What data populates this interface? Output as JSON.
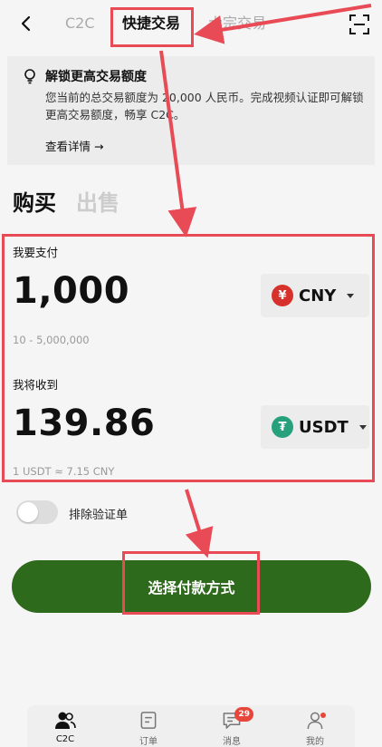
{
  "header": {
    "tabs": [
      "C2C",
      "快捷交易",
      "大宗交易"
    ],
    "active_tab": 1
  },
  "notice": {
    "title": "解锁更高交易额度",
    "body": "您当前的总交易额度为 20,000 人民币。完成视频认证即可解锁更高交易额度，畅享 C2C。",
    "link": "查看详情 →"
  },
  "mode": {
    "buy": "购买",
    "sell": "出售",
    "active": "buy"
  },
  "pay": {
    "label": "我要支付",
    "amount": "1,000",
    "currency": "CNY",
    "currency_symbol": "¥",
    "range": "10 - 5,000,000"
  },
  "receive": {
    "label": "我将收到",
    "amount": "139.86",
    "currency": "USDT",
    "currency_symbol": "₮",
    "rate": "1 USDT ≈ 7.15 CNY"
  },
  "toggle": {
    "label": "排除验证单",
    "on": false
  },
  "cta": {
    "label": "选择付款方式"
  },
  "bottom_nav": {
    "items": [
      {
        "label": "C2C",
        "icon": "users-icon",
        "active": true
      },
      {
        "label": "订单",
        "icon": "order-icon"
      },
      {
        "label": "消息",
        "icon": "message-icon",
        "badge": "29"
      },
      {
        "label": "我的",
        "icon": "profile-icon"
      }
    ]
  },
  "colors": {
    "accent": "#2e6a1b",
    "highlight": "#e94b56",
    "cny": "#d6322b",
    "usdt": "#26a17b"
  }
}
